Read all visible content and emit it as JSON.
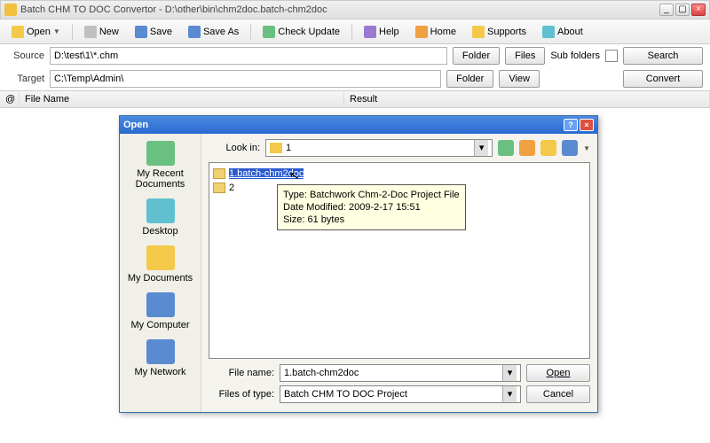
{
  "window": {
    "title": "Batch CHM TO DOC Convertor - D:\\other\\bin\\chm2doc.batch-chm2doc"
  },
  "toolbar": {
    "open": "Open",
    "new": "New",
    "save": "Save",
    "saveas": "Save As",
    "check": "Check Update",
    "help": "Help",
    "home": "Home",
    "supports": "Supports",
    "about": "About"
  },
  "source": {
    "label": "Source",
    "value": "D:\\test\\1\\*.chm"
  },
  "target": {
    "label": "Target",
    "value": "C:\\Temp\\Admin\\"
  },
  "buttons": {
    "folder": "Folder",
    "files": "Files",
    "view": "View",
    "subfolders": "Sub folders",
    "search": "Search",
    "convert": "Convert"
  },
  "grid": {
    "at": "@",
    "filename": "File Name",
    "result": "Result"
  },
  "dialog": {
    "title": "Open",
    "lookin_label": "Look in:",
    "lookin_value": "1",
    "places": {
      "recent": "My Recent Documents",
      "desktop": "Desktop",
      "mydocs": "My Documents",
      "mycomp": "My Computer",
      "mynet": "My Network"
    },
    "files": {
      "f1": "1.batch-chm2doc",
      "f2": "2"
    },
    "tooltip": {
      "l1": "Type: Batchwork Chm-2-Doc Project File",
      "l2": "Date Modified: 2009-2-17 15:51",
      "l3": "Size: 61 bytes"
    },
    "filename_label": "File name:",
    "filename_value": "1.batch-chm2doc",
    "filetype_label": "Files of type:",
    "filetype_value": "Batch CHM TO DOC Project",
    "open": "Open",
    "cancel": "Cancel"
  }
}
